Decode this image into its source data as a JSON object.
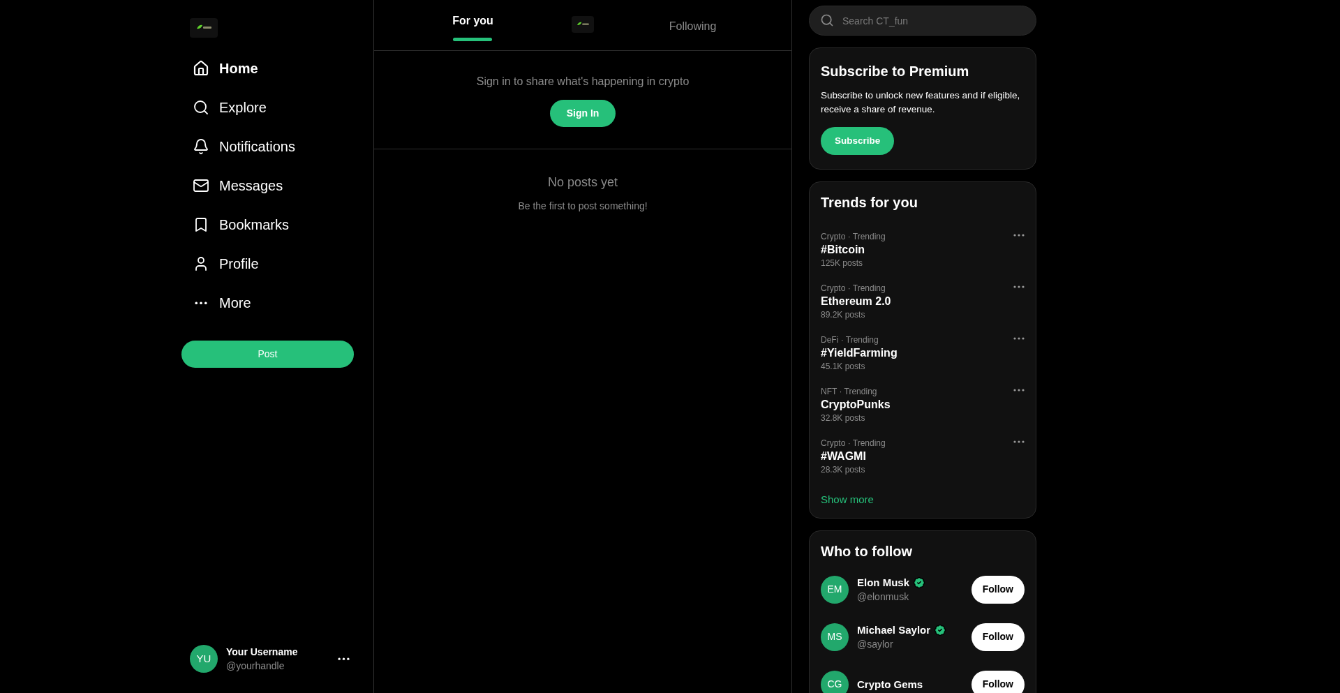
{
  "sidebar": {
    "items": [
      {
        "kind": "home",
        "label": "Home",
        "selected": true
      },
      {
        "kind": "search",
        "label": "Explore",
        "selected": false
      },
      {
        "kind": "bell",
        "label": "Notifications",
        "selected": false
      },
      {
        "kind": "mail",
        "label": "Messages",
        "selected": false
      },
      {
        "kind": "bookmark",
        "label": "Bookmarks",
        "selected": false
      },
      {
        "kind": "user",
        "label": "Profile",
        "selected": false
      },
      {
        "kind": "more",
        "label": "More",
        "selected": false
      }
    ],
    "post_button": "Post",
    "account": {
      "initials": "YU",
      "name": "Your Username",
      "handle": "@yourhandle"
    }
  },
  "feed": {
    "tabs": [
      {
        "label": "For you",
        "selected": true
      },
      {
        "label": "Following",
        "selected": false
      }
    ],
    "prompt": "Sign in to share what's happening in crypto",
    "sign_in": "Sign In",
    "empty_title": "No posts yet",
    "empty_text": "Be the first to post something!"
  },
  "search": {
    "placeholder": "Search CT_fun"
  },
  "premium": {
    "title": "Subscribe to Premium",
    "text": "Subscribe to unlock new features and if eligible, receive a share of revenue.",
    "button": "Subscribe"
  },
  "trends": {
    "title": "Trends for you",
    "items": [
      {
        "context": "Crypto · Trending",
        "topic": "#Bitcoin",
        "posts": "125K posts"
      },
      {
        "context": "Crypto · Trending",
        "topic": "Ethereum 2.0",
        "posts": "89.2K posts"
      },
      {
        "context": "DeFi · Trending",
        "topic": "#YieldFarming",
        "posts": "45.1K posts"
      },
      {
        "context": "NFT · Trending",
        "topic": "CryptoPunks",
        "posts": "32.8K posts"
      },
      {
        "context": "Crypto · Trending",
        "topic": "#WAGMI",
        "posts": "28.3K posts"
      }
    ],
    "show_more": "Show more"
  },
  "who_to_follow": {
    "title": "Who to follow",
    "people": [
      {
        "initials": "EM",
        "name": "Elon Musk",
        "handle": "@elonmusk",
        "verified": true,
        "button": "Follow"
      },
      {
        "initials": "MS",
        "name": "Michael Saylor",
        "handle": "@saylor",
        "verified": true,
        "button": "Follow"
      },
      {
        "initials": "CG",
        "name": "Crypto Gems",
        "verified": false,
        "button": "Follow"
      }
    ]
  }
}
